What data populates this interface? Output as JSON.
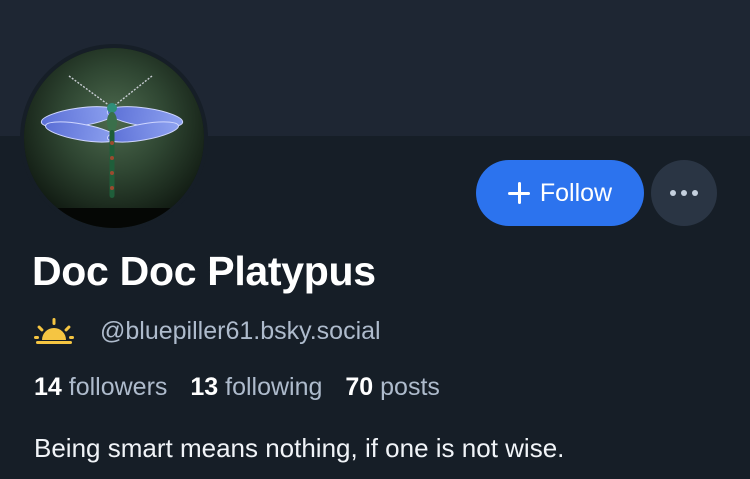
{
  "profile": {
    "display_name": "Doc Doc Platypus",
    "handle": "@bluepiller61.bsky.social",
    "bio": "Being smart means nothing, if one is not wise.",
    "avatar_icon": "dragonfly-avatar",
    "handle_icon": "sun-icon"
  },
  "actions": {
    "follow_label": "Follow",
    "more_icon": "more-options-icon"
  },
  "stats": {
    "followers_count": "14",
    "followers_label": "followers",
    "following_count": "13",
    "following_label": "following",
    "posts_count": "70",
    "posts_label": "posts"
  },
  "colors": {
    "background": "#161e27",
    "banner": "#1e2633",
    "follow_button": "#2c73ee",
    "more_button": "#2a3544",
    "secondary_text": "#aebbcc",
    "sun": "#f5c542"
  }
}
